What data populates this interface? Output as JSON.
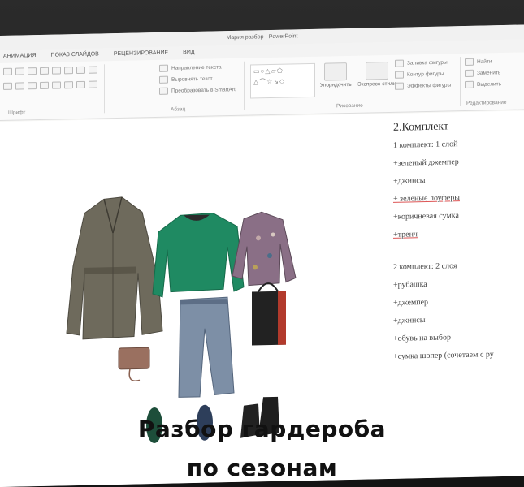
{
  "window": {
    "title": "Мария разбор - PowerPoint"
  },
  "tabs": [
    "АНИМАЦИЯ",
    "ПОКАЗ СЛАЙДОВ",
    "РЕЦЕНЗИРОВАНИЕ",
    "ВИД"
  ],
  "ribbon": {
    "paragraph_cmds": [
      "Направление текста",
      "Выровнять текст",
      "Преобразовать в SmartArt"
    ],
    "arrange_label": "Упорядочить",
    "quick_styles_label": "Экспресс-стили",
    "drawing_cmds": [
      "Заливка фигуры",
      "Контур фигуры",
      "Эффекты фигуры"
    ],
    "editing_cmds": [
      "Найти",
      "Заменить",
      "Выделить"
    ],
    "groups": {
      "font": "Шрифт",
      "paragraph": "Абзац",
      "drawing": "Рисование",
      "editing": "Редактирование"
    }
  },
  "slide": {
    "heading": "2.Комплект",
    "set1_title": "1 комплект: 1 слой",
    "set1_items": [
      "+зеленый джемпер",
      "+джинсы",
      "+ зеленые лоуферы",
      "+коричневая сумка",
      "+тренч"
    ],
    "set2_title": "2 комплект: 2 слоя",
    "set2_items": [
      "+рубашка",
      "+джемпер",
      "+джинсы",
      "+обувь на выбор",
      "+сумка шопер (сочетаем с ру"
    ]
  },
  "caption": {
    "line1": "Разбор гардероба",
    "line2": "по сезонам"
  },
  "colors": {
    "jumper": "#1f8a62",
    "trench": "#6e6a5c",
    "jeans": "#7d8fa6",
    "shirt": "#8a6f86",
    "bag": "#b23a2c",
    "boots": "#222222"
  }
}
